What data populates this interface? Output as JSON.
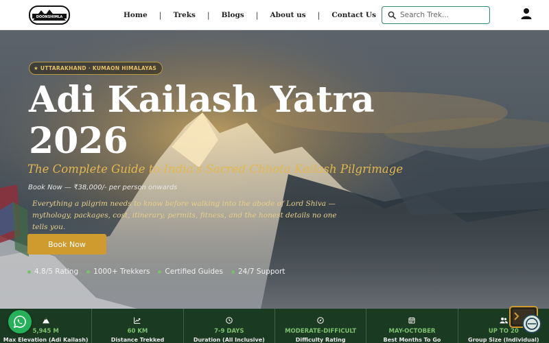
{
  "nav": {
    "logo_text": "DOONSHIMLA",
    "items": [
      {
        "label": "Home"
      },
      {
        "label": "Treks"
      },
      {
        "label": "Blogs"
      },
      {
        "label": "About us"
      },
      {
        "label": "Contact Us"
      }
    ],
    "separator": "|",
    "search_placeholder": "Search Trek..."
  },
  "hero": {
    "badge": "★ UTTARAKHAND · KUMAON HIMALAYAS",
    "title_line1": "Adi Kailash Yatra",
    "title_line2": "2026",
    "subtitle": "The Complete Guide to India's Sacred Chhota Kailash Pilgrimage",
    "price": "Book Now — ₹38,000/- per person onwards",
    "description": "Everything a pilgrim needs to know before walking into the abode of Lord Shiva — mythology, packages, cost, itinerary, permits, fitness, and the honest details no one tells you.",
    "book_button": "Book Now",
    "features": [
      "4.8/5 Rating",
      "1000+ Trekkers",
      "Certified Guides",
      "24/7 Support"
    ]
  },
  "stats": [
    {
      "icon": "mountain-icon",
      "value": "5,945 M",
      "label": "Max Elevation (Adi Kailash)"
    },
    {
      "icon": "chart-up-icon",
      "value": "60 KM",
      "label": "Distance Trekked"
    },
    {
      "icon": "clock-icon",
      "value": "7-9 DAYS",
      "label": "Duration (All Inclusive)"
    },
    {
      "icon": "compass-icon",
      "value": "MODERATE-DIFFICULT",
      "label": "Difficulty Rating"
    },
    {
      "icon": "calendar-icon",
      "value": "MAY-OCTOBER",
      "label": "Best Months To Go"
    },
    {
      "icon": "group-icon",
      "value": "UP TO 20",
      "label": "Group Size (Individual)"
    }
  ],
  "colors": {
    "accent_gold": "#cf9a2e",
    "stats_bg": "#1b3a22",
    "stat_value": "#7dc06f",
    "search_border": "#2e8b6e",
    "whatsapp": "#25b159"
  }
}
